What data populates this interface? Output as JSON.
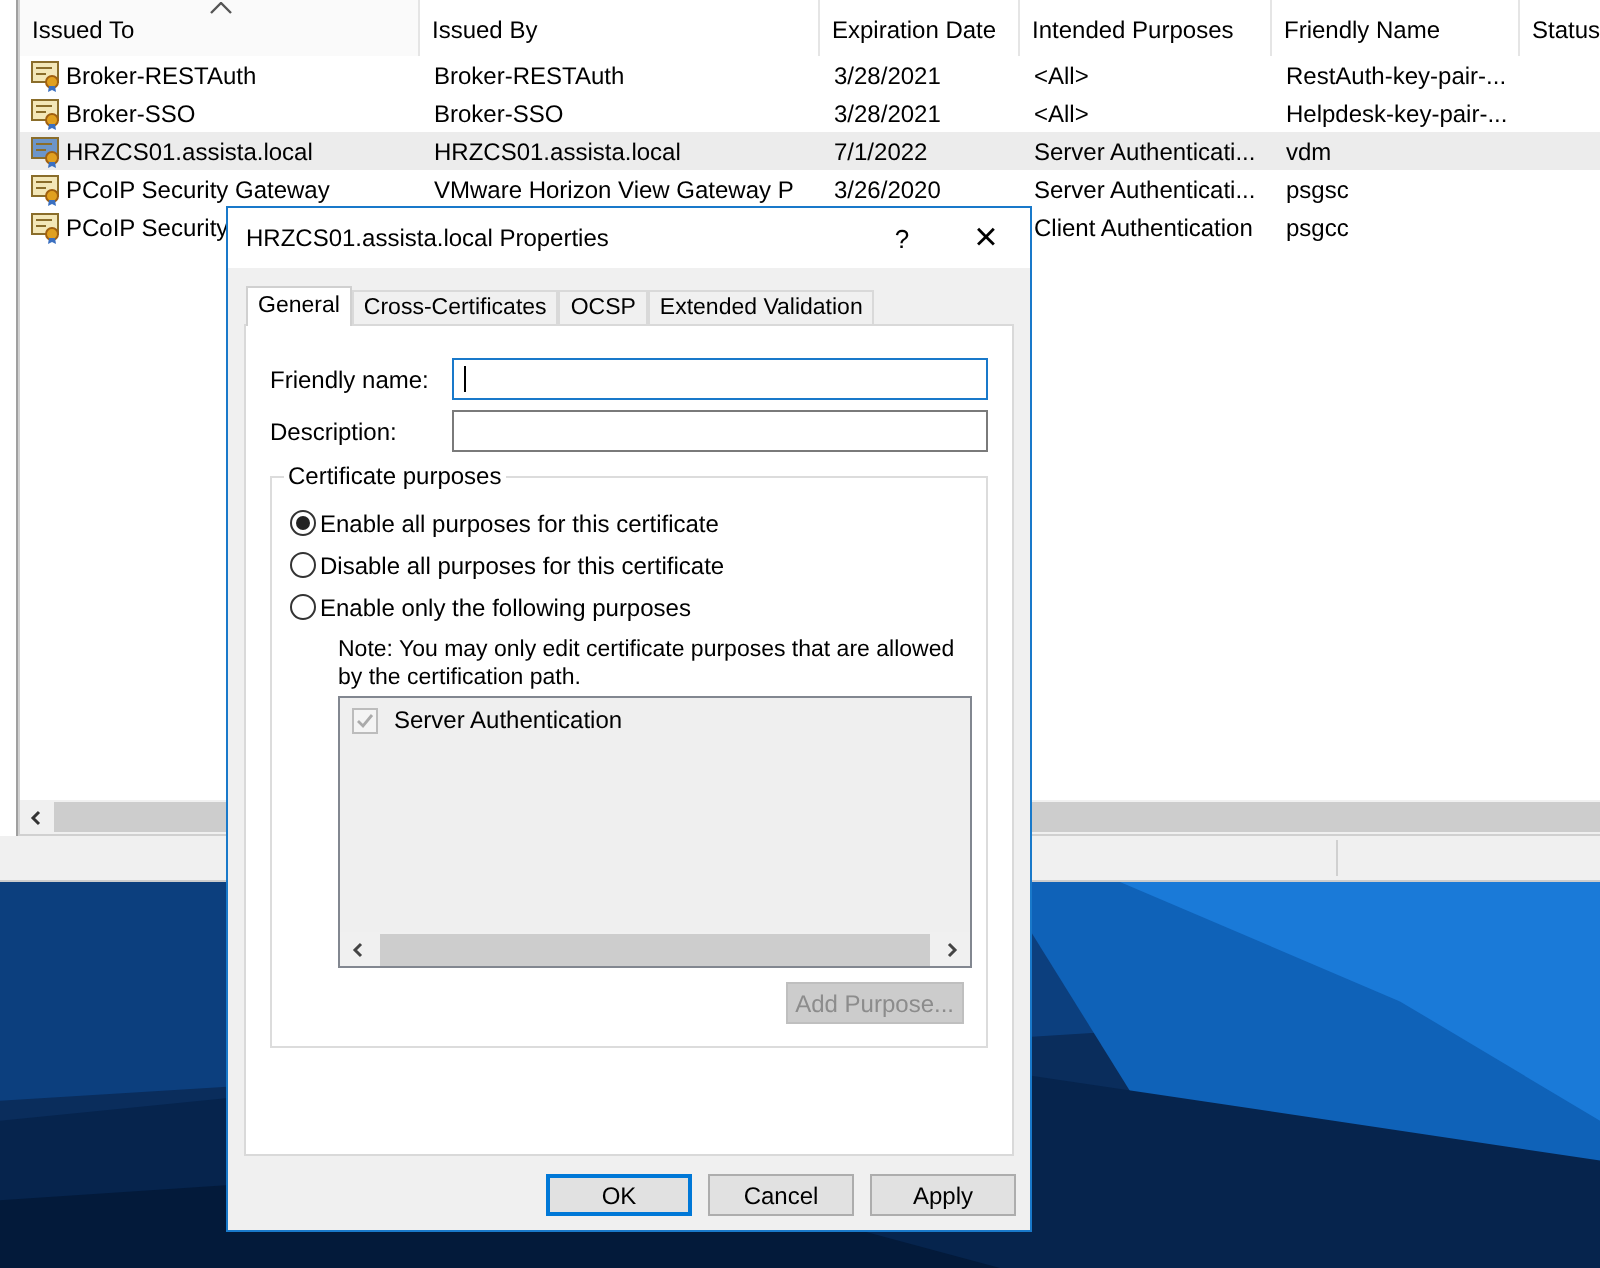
{
  "list": {
    "columns": [
      {
        "label": "Issued To",
        "sorted": true
      },
      {
        "label": "Issued By",
        "sorted": false
      },
      {
        "label": "Expiration Date",
        "sorted": false
      },
      {
        "label": "Intended Purposes",
        "sorted": false
      },
      {
        "label": "Friendly Name",
        "sorted": false
      },
      {
        "label": "Status",
        "sorted": false
      }
    ],
    "rows": [
      {
        "cells": [
          "Broker-RESTAuth",
          "Broker-RESTAuth",
          "3/28/2021",
          "<All>",
          "RestAuth-key-pair-..."
        ],
        "selected": false
      },
      {
        "cells": [
          "Broker-SSO",
          "Broker-SSO",
          "3/28/2021",
          "<All>",
          "Helpdesk-key-pair-..."
        ],
        "selected": false
      },
      {
        "cells": [
          "HRZCS01.assista.local",
          "HRZCS01.assista.local",
          "7/1/2022",
          "Server Authenticati...",
          "vdm"
        ],
        "selected": true
      },
      {
        "cells": [
          "PCoIP Security Gateway",
          "VMware Horizon View Gateway P",
          "3/26/2020",
          "Server Authenticati...",
          "psgsc"
        ],
        "selected": false
      },
      {
        "cells": [
          "PCoIP Security",
          null,
          null,
          "Client Authentication",
          "psgcc"
        ],
        "selected": false
      }
    ]
  },
  "dialog": {
    "title": "HRZCS01.assista.local Properties",
    "help": "?",
    "close": "×",
    "tabs": [
      {
        "label": "General",
        "selected": true
      },
      {
        "label": "Cross-Certificates",
        "selected": false
      },
      {
        "label": "OCSP",
        "selected": false
      },
      {
        "label": "Extended Validation",
        "selected": false
      }
    ],
    "fields": [
      {
        "label": "Friendly name:",
        "focused": true
      },
      {
        "label": "Description:",
        "focused": false
      }
    ],
    "group": {
      "title": "Certificate purposes",
      "options": [
        {
          "label": "Enable all purposes for this certificate",
          "selected": true
        },
        {
          "label": "Disable all purposes for this certificate",
          "selected": false
        },
        {
          "label": "Enable only the following purposes",
          "selected": false
        }
      ],
      "note": "Note: You may only edit certificate purposes that are allowed by the certification path.",
      "purposes": [
        {
          "label": "Server Authentication",
          "checked": true,
          "disabled": true
        }
      ],
      "add_button": {
        "label": "Add Purpose...",
        "disabled": true
      }
    },
    "buttons": [
      {
        "label": "OK",
        "default": true
      },
      {
        "label": "Cancel",
        "default": false
      },
      {
        "label": "Apply",
        "default": false
      }
    ]
  }
}
